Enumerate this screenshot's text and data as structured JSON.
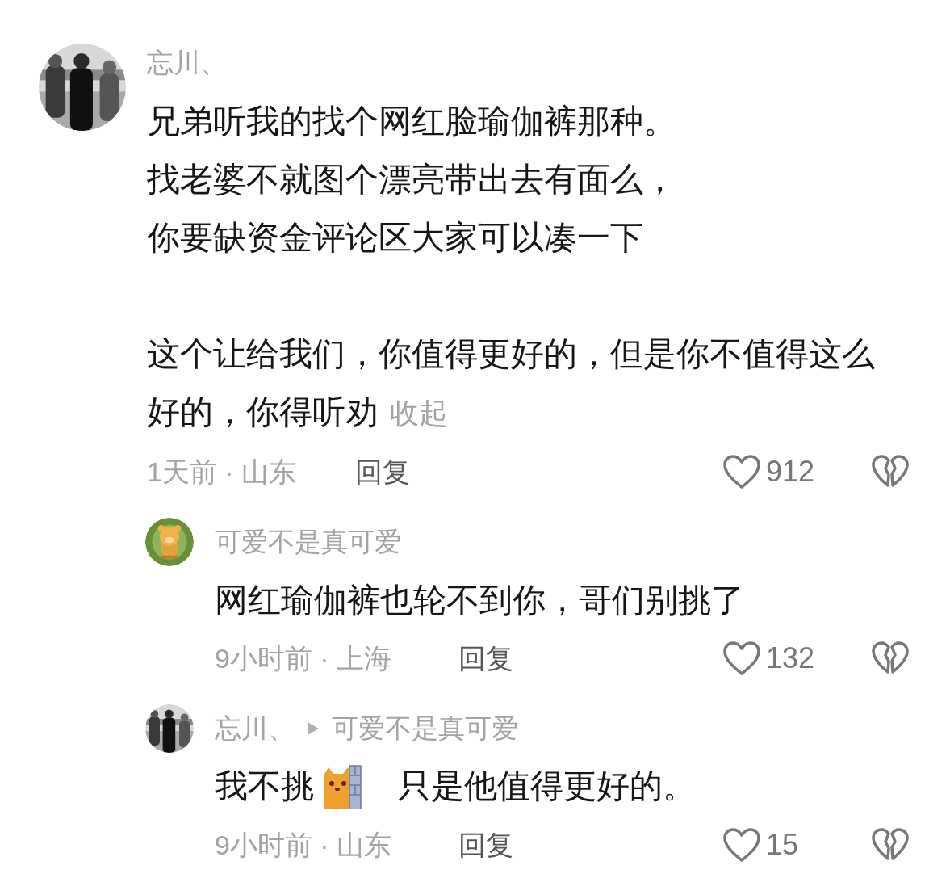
{
  "comments": [
    {
      "username": "忘川、",
      "body": [
        {
          "kind": "line",
          "text": "兄弟听我的找个网红脸瑜伽裤那种。"
        },
        {
          "kind": "line",
          "text": "找老婆不就图个漂亮带出去有面么，"
        },
        {
          "kind": "line",
          "text": "你要缺资金评论区大家可以凑一下"
        },
        {
          "kind": "blank"
        },
        {
          "kind": "line",
          "text": "这个让给我们，你值得更好的，但是你不值得这么好的，你得听劝",
          "link": "收起"
        }
      ],
      "time_location": "1天前 · 山东",
      "reply_label": "回复",
      "likes": "912"
    },
    {
      "avatar": {
        "kind": "cartoon"
      },
      "username": "可爱不是真可爱",
      "body": [
        {
          "kind": "line",
          "text": "网红瑜伽裤也轮不到你，哥们别挑了"
        }
      ],
      "time_location": "9小时前 · 上海",
      "reply_label": "回复",
      "likes": "132"
    },
    {
      "username": "忘川、",
      "reply_to": "可爱不是真可爱",
      "body": [
        {
          "kind": "inline",
          "parts": [
            {
              "kind": "text",
              "text": "我不挑"
            },
            {
              "kind": "emoji"
            },
            {
              "kind": "text",
              "text": "只是他值得更好的。"
            }
          ]
        }
      ],
      "time_location": "9小时前 · 山东",
      "reply_label": "回复",
      "likes": "15"
    }
  ]
}
